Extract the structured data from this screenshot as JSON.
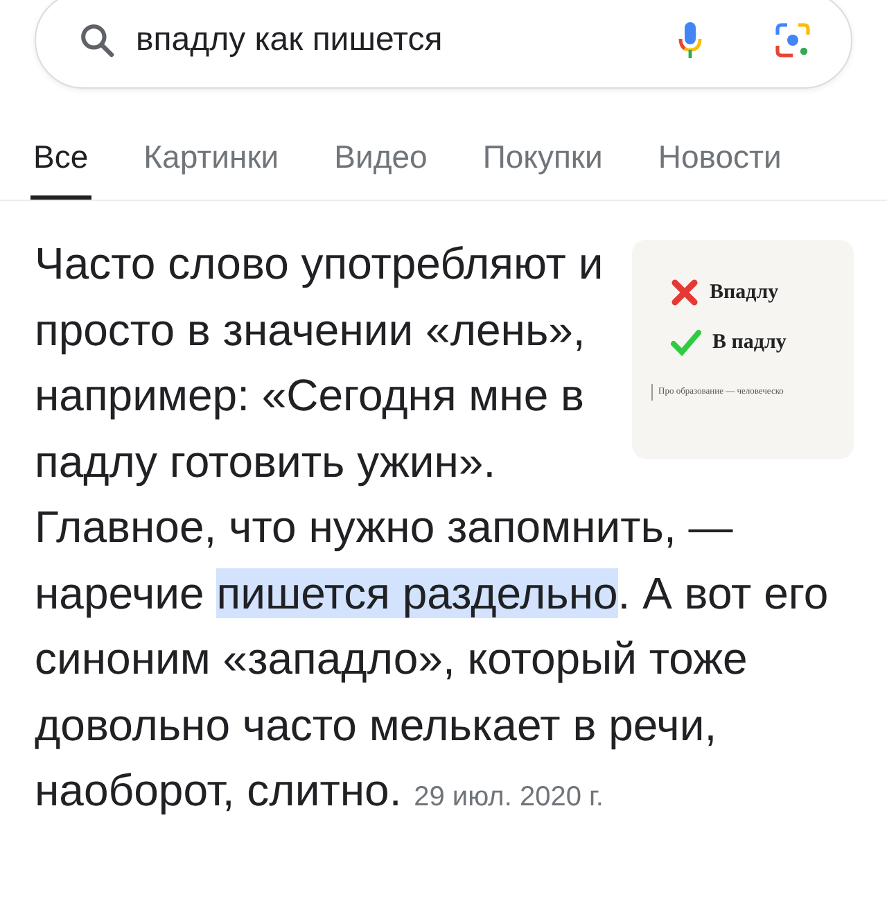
{
  "search": {
    "value": "впадлу как пишется"
  },
  "tabs": [
    {
      "label": "Все",
      "selected": true
    },
    {
      "label": "Картинки",
      "selected": false
    },
    {
      "label": "Видео",
      "selected": false
    },
    {
      "label": "Покупки",
      "selected": false
    },
    {
      "label": "Новости",
      "selected": false
    }
  ],
  "snippet": {
    "before": "Часто слово употребляют и просто в значении «лень», например: «Сегодня мне в падлу готовить ужин». Главное, что нужно запомнить, — наречие ",
    "highlight": "пишется раздельно",
    "after": ". А вот его синоним «западло», который тоже довольно часто мелькает в речи, наоборот, слитно.",
    "date": "29 июл. 2020 г.",
    "thumbnail": {
      "wrong": "Впадлу",
      "right": "В падлу",
      "caption": "Про образование — человеческо"
    }
  }
}
